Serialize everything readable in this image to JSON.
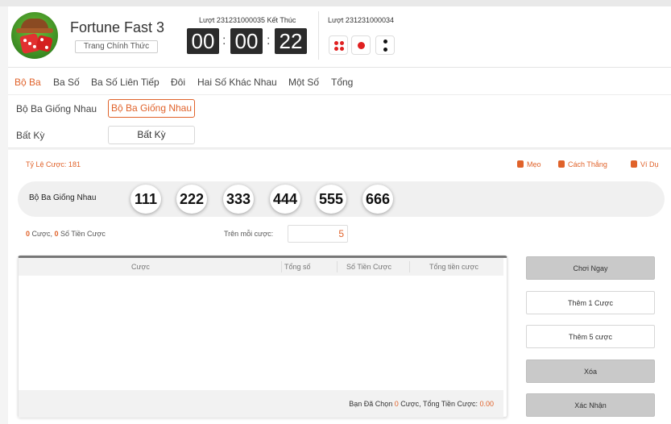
{
  "header": {
    "title": "Fortune Fast 3",
    "official_btn": "Trang Chính Thức",
    "round_label": "Lượt 231231000035 Kết Thúc",
    "timer": [
      "00",
      "00",
      "22"
    ],
    "timer_sep": ":",
    "last_round_label": "Lượt 231231000034"
  },
  "tabs": [
    "Bộ Ba",
    "Ba Số",
    "Ba Số Liên Tiếp",
    "Đôi",
    "Hai Số Khác Nhau",
    "Một Số",
    "Tổng"
  ],
  "sub": {
    "row1_label": "Bộ Ba Giống Nhau",
    "row1_btn": "Bộ Ba Giống Nhau",
    "row2_label": "Bất Kỳ",
    "row2_btn": "Bất Kỳ"
  },
  "bet": {
    "odds": "Tỷ Lệ Cược: 181",
    "tip": "Mẹo",
    "how_to_win": "Cách Thắng",
    "example": "Ví Dụ",
    "pick_label": "Bộ Ba Giống Nhau",
    "balls": [
      "111",
      "222",
      "333",
      "444",
      "555",
      "666"
    ],
    "count_bets": "0",
    "count_bets_text": " Cược, ",
    "count_amount": "0",
    "count_amount_text": " Số Tiền Cược",
    "per_bet_label": "Trên mỗi cược:",
    "per_bet_value": "5"
  },
  "table": {
    "headers": [
      "Cược",
      "Tổng số",
      "Số Tiền Cược",
      "Tổng tiền cược"
    ],
    "footer_prefix": "Bạn Đã Chọn ",
    "footer_count": "0",
    "footer_mid": " Cược, Tổng Tiền Cược: ",
    "footer_total": "0.00"
  },
  "actions": {
    "play_now": "Chơi Ngay",
    "add_one": "Thêm 1 Cược",
    "add_five": "Thêm 5 cược",
    "delete": "Xóa",
    "confirm": "Xác Nhận"
  },
  "colors": {
    "accent": "#e0622a",
    "die_red": "#e02020",
    "die_black": "#111111"
  },
  "icons": {
    "tip": "lightbulb-icon",
    "how_to_win": "document-icon",
    "example": "copy-icon"
  }
}
